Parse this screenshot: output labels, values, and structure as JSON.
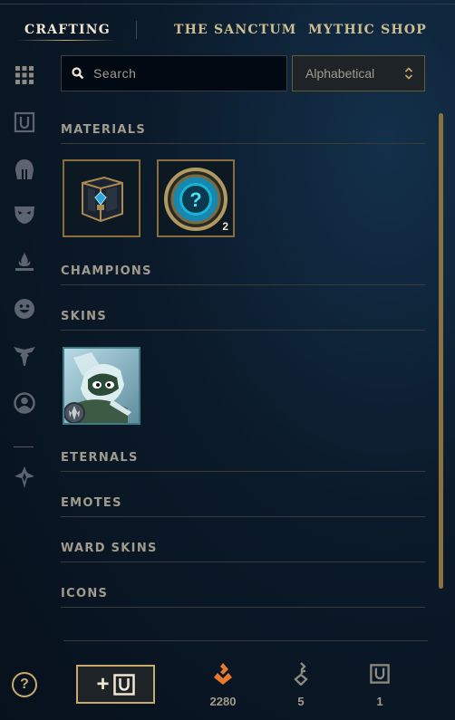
{
  "tabs": [
    {
      "label": "CRAFTING",
      "active": true
    },
    {
      "label": "THE SANCTUM",
      "active": false
    },
    {
      "label": "MYTHIC SHOP",
      "active": false
    }
  ],
  "sidebar": {
    "icons": [
      "grid-icon",
      "chest-icon",
      "helmet-icon",
      "mask-icon",
      "ward-icon",
      "emote-icon",
      "eternals-icon",
      "profile-icon",
      "anvil-icon"
    ]
  },
  "search": {
    "placeholder": "Search"
  },
  "sort": {
    "label": "Alphabetical"
  },
  "sections": {
    "materials": "MATERIALS",
    "champions": "CHAMPIONS",
    "skins": "SKINS",
    "eternals": "ETERNALS",
    "emotes": "EMOTES",
    "ward_skins": "WARD SKINS",
    "icons": "ICONS"
  },
  "materials": [
    {
      "icon": "hextech-chest-icon",
      "count": ""
    },
    {
      "icon": "mystery-orb-icon",
      "count": "2"
    }
  ],
  "skins": [
    {
      "icon": "skin-shard-icon"
    }
  ],
  "footer": {
    "help": "?",
    "add_button_plus": "+",
    "orange_essence": "2280",
    "keys": "5",
    "chests": "1"
  },
  "colors": {
    "gold": "#c8aa6e",
    "orange_essence": "#e8792f",
    "text": "#a09b8c"
  }
}
